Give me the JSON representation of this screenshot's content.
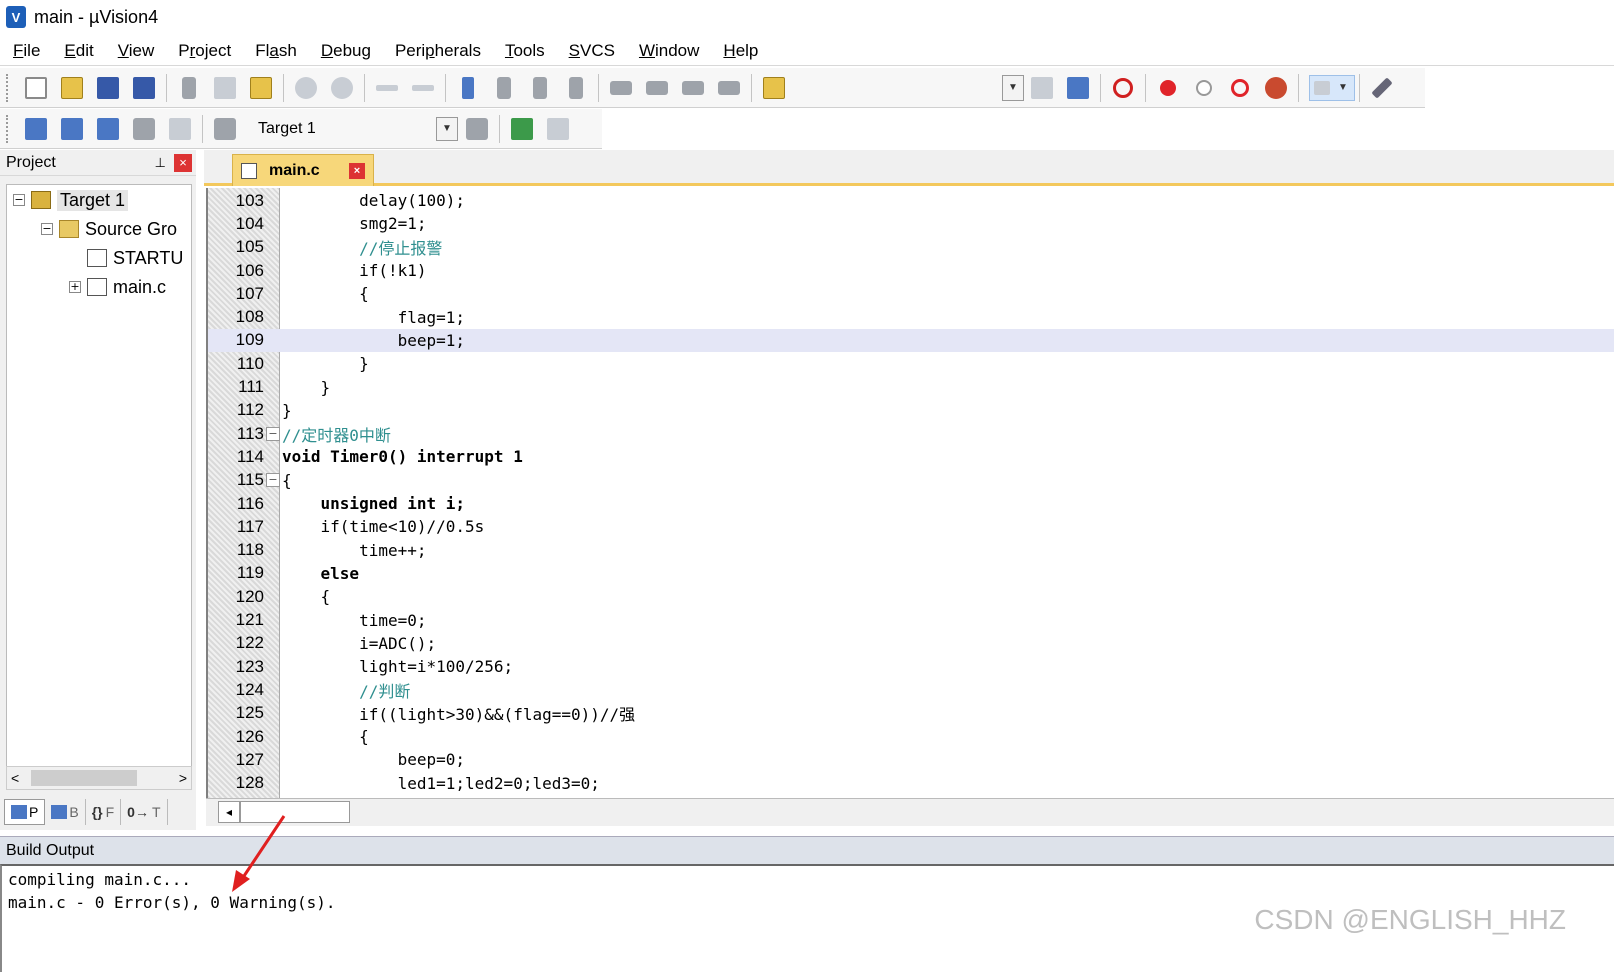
{
  "window": {
    "title": "main  - µVision4",
    "app_icon_glyph": "V"
  },
  "menu": [
    {
      "ul": "F",
      "rest": "ile"
    },
    {
      "ul": "E",
      "rest": "dit"
    },
    {
      "ul": "V",
      "rest": "iew"
    },
    {
      "pre": "P",
      "ul": "r",
      "rest": "oject"
    },
    {
      "pre": "Fl",
      "ul": "a",
      "rest": "sh"
    },
    {
      "ul": "D",
      "rest": "ebug"
    },
    {
      "pre": "Peri",
      "ul": "p",
      "rest": "herals"
    },
    {
      "ul": "T",
      "rest": "ools"
    },
    {
      "ul": "S",
      "rest": "VCS"
    },
    {
      "ul": "W",
      "rest": "indow"
    },
    {
      "ul": "H",
      "rest": "elp"
    }
  ],
  "toolbar2": {
    "target_combo": "Target 1"
  },
  "project_panel": {
    "title": "Project",
    "pin_glyph": "⊥",
    "close_glyph": "×",
    "tree": [
      {
        "label": "Target 1",
        "expander": "−",
        "kind": "target",
        "selected": true
      },
      {
        "label": "Source Gro",
        "expander": "−",
        "kind": "folder"
      },
      {
        "label": "STARTU",
        "expander": "",
        "kind": "file"
      },
      {
        "label": "main.c",
        "expander": "+",
        "kind": "file"
      }
    ],
    "scroll_left": "<",
    "scroll_right": ">",
    "tabs": [
      {
        "label": "P"
      },
      {
        "label": "B"
      },
      {
        "label": "F"
      },
      {
        "label": "T"
      }
    ],
    "tab_glyphs": [
      "",
      "",
      "{}",
      "0→"
    ]
  },
  "editor": {
    "tab_label": "main.c",
    "tab_close": "×",
    "lines": [
      {
        "n": "103",
        "text": "        delay(100);"
      },
      {
        "n": "104",
        "text": "        smg2=1;"
      },
      {
        "n": "105",
        "text": "        //停止报警",
        "comment": true
      },
      {
        "n": "106",
        "text": "        if(!k1)"
      },
      {
        "n": "107",
        "text": "        {"
      },
      {
        "n": "108",
        "text": "            flag=1;"
      },
      {
        "n": "109",
        "text": "            beep=1;",
        "highlight": true
      },
      {
        "n": "110",
        "text": "        }"
      },
      {
        "n": "111",
        "text": "    }"
      },
      {
        "n": "112",
        "text": "}"
      },
      {
        "n": "113",
        "text": "//定时器0中断",
        "comment": true,
        "fold": "−"
      },
      {
        "n": "114",
        "text": "void Timer0() interrupt 1"
      },
      {
        "n": "115",
        "text": "{",
        "fold": "−"
      },
      {
        "n": "116",
        "text": "    unsigned int i;"
      },
      {
        "n": "117",
        "text": "    if(time<10)//0.5s"
      },
      {
        "n": "118",
        "text": "        time++;"
      },
      {
        "n": "119",
        "text": "    else"
      },
      {
        "n": "120",
        "text": "    {"
      },
      {
        "n": "121",
        "text": "        time=0;"
      },
      {
        "n": "122",
        "text": "        i=ADC();"
      },
      {
        "n": "123",
        "text": "        light=i*100/256;"
      },
      {
        "n": "124",
        "text": "        //判断",
        "comment": true
      },
      {
        "n": "125",
        "text": "        if((light>30)&&(flag==0))//强"
      },
      {
        "n": "126",
        "text": "        {"
      },
      {
        "n": "127",
        "text": "            beep=0;"
      },
      {
        "n": "128",
        "text": "            led1=1;led2=0;led3=0;"
      }
    ],
    "scroll_left": "◂"
  },
  "build_output": {
    "title": "Build Output",
    "lines": [
      "compiling main.c...",
      "main.c - 0 Error(s), 0 Warning(s)."
    ]
  },
  "watermark": "CSDN @ENGLISH_HHZ",
  "colors": {
    "tab_accent": "#f7d77a",
    "current_line": "#e4e6f6",
    "comment": "#2f8f8f",
    "arrow": "#e02020"
  }
}
